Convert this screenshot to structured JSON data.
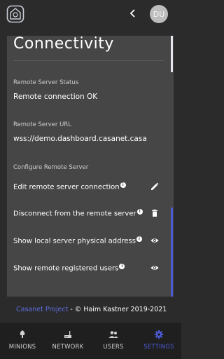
{
  "header": {
    "avatar_initials": "DU",
    "logo_icon": "casanet-logo-icon",
    "back_icon": "chevron-left-icon"
  },
  "page": {
    "title": "Connectivity"
  },
  "status": {
    "label": "Remote Server Status",
    "value": "Remote connection OK"
  },
  "url": {
    "label": "Remote Server URL",
    "value": "wss://demo.dashboard.casanet.casa"
  },
  "configure": {
    "label": "Configure Remote Server",
    "actions": [
      {
        "label": "Edit remote server connection",
        "icon": "pencil-icon"
      },
      {
        "label": "Disconnect from the remote server",
        "icon": "trash-icon"
      },
      {
        "label": "Show local server physical address",
        "icon": "eye-icon"
      },
      {
        "label": "Show remote registered users",
        "icon": "eye-icon"
      }
    ]
  },
  "footer": {
    "link": "Casanet Project",
    "text": " - © Haim Kastner 2019-2021"
  },
  "nav": {
    "items": [
      {
        "label": "MINIONS",
        "icon": "minion-icon"
      },
      {
        "label": "NETWORK",
        "icon": "router-icon"
      },
      {
        "label": "USERS",
        "icon": "users-icon"
      },
      {
        "label": "SETTINGS",
        "icon": "gear-icon"
      }
    ],
    "active": "SETTINGS"
  },
  "colors": {
    "background": "#2b2b2b",
    "card": "#464646",
    "accent": "#4b5bd6",
    "link": "#5b6ee0",
    "nav_background": "#1f1f1f"
  }
}
